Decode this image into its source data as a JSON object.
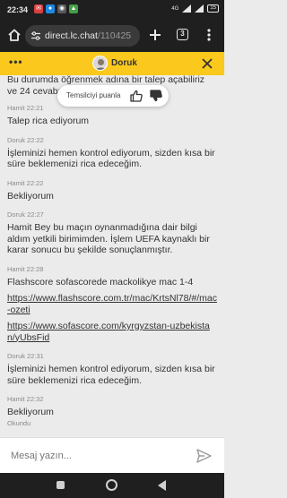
{
  "statusbar": {
    "time": "22:34",
    "network": "4G",
    "battery": "15"
  },
  "browser": {
    "url_host": "direct.lc.chat",
    "url_path": "/110425",
    "tab_count": "3"
  },
  "chat_header": {
    "agent_name": "Doruk"
  },
  "rating": {
    "label": "Temsilciyi puanla"
  },
  "messages": [
    {
      "text": "Bu durumda öğrenmek adına bir talep açabiliriz ve 24 cevabı geleceki"
    },
    {
      "author": "Hamit 22:21",
      "text": "Talep rica ediyorum"
    },
    {
      "author": "Doruk 22:22",
      "text": "İşleminizi hemen kontrol ediyorum, sizden kısa bir süre beklemenizi rica edeceğim."
    },
    {
      "author": "Hamit 22:22",
      "text": "Bekliyorum"
    },
    {
      "author": "Doruk 22:27",
      "text": "Hamit Bey bu maçın oynanmadığına dair bilgi aldım yetkili birimimden. İşlem UEFA kaynaklı bir karar sonucu bu şekilde sonuçlanmıştır."
    },
    {
      "author": "Hamit 22:28",
      "text": "Flashscore sofascorede mackolikye mac 1-4",
      "link1": "https://www.flashscore.com.tr/mac/KrtsNl78/#/mac-ozeti",
      "link2": "https://www.sofascore.com/kyrgyzstan-uzbekistan/yUbsFid"
    },
    {
      "author": "Doruk 22:31",
      "text": "İşleminizi hemen kontrol ediyorum, sizden kısa bir süre beklemenizi rica edeceğim."
    },
    {
      "author": "Hamit 22:32",
      "text": "Bekliyorum",
      "status": "Okundu"
    }
  ],
  "composer": {
    "placeholder": "Mesaj yazın..."
  },
  "colors": {
    "accent": "#fbc91d",
    "chrome": "#1f1f1f",
    "chat_bg": "#ebebeb"
  }
}
